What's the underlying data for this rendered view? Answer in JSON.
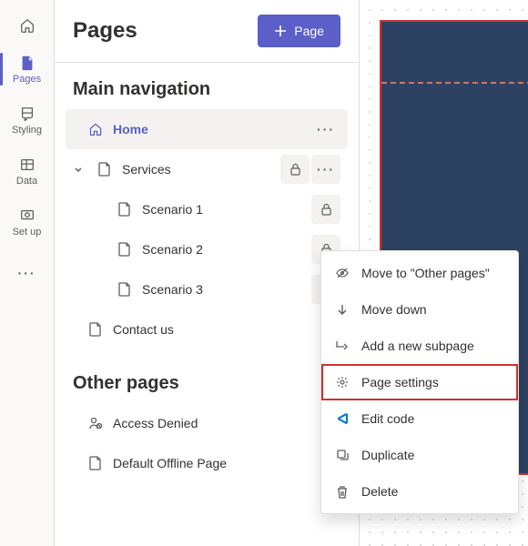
{
  "rail": {
    "items": [
      {
        "name": "home",
        "label": ""
      },
      {
        "name": "pages",
        "label": "Pages"
      },
      {
        "name": "styling",
        "label": "Styling"
      },
      {
        "name": "data",
        "label": "Data"
      },
      {
        "name": "setup",
        "label": "Set up"
      },
      {
        "name": "more",
        "label": ""
      }
    ]
  },
  "panel": {
    "title": "Pages",
    "add_button": "Page",
    "section1": "Main navigation",
    "section2": "Other pages"
  },
  "pages": {
    "home": "Home",
    "services": "Services",
    "scenario1": "Scenario 1",
    "scenario2": "Scenario 2",
    "scenario3": "Scenario 3",
    "contact": "Contact us",
    "access_denied": "Access Denied",
    "default_offline": "Default Offline Page"
  },
  "menu": {
    "move_to_other": "Move to \"Other pages\"",
    "move_down": "Move down",
    "add_subpage": "Add a new subpage",
    "page_settings": "Page settings",
    "edit_code": "Edit code",
    "duplicate": "Duplicate",
    "delete": "Delete"
  }
}
